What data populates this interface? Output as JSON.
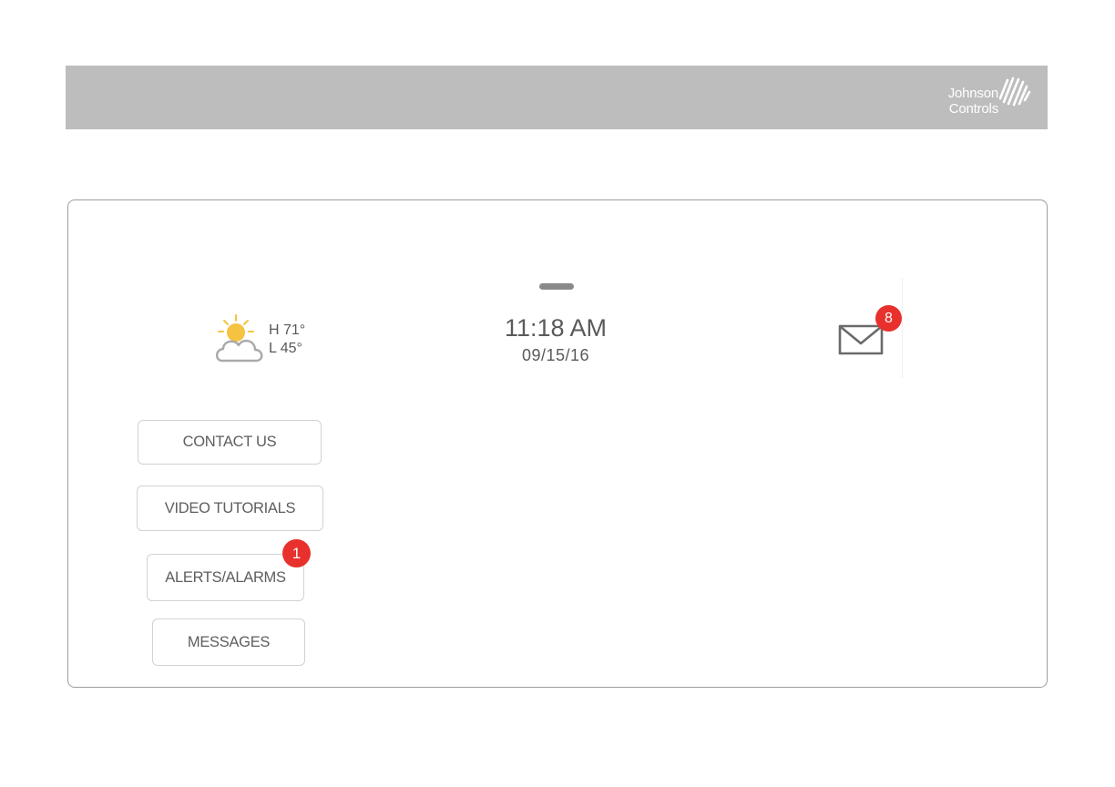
{
  "header": {
    "brand_line1": "Johnson",
    "brand_line2": "Controls",
    "background_color": "#bdbdbd"
  },
  "weather": {
    "icon": "partly-cloudy-icon",
    "high": "H 71°",
    "low": "L 45°"
  },
  "clock": {
    "time": "11:18 AM",
    "date": "09/15/16"
  },
  "mail": {
    "icon": "envelope-icon",
    "badge_count": "8"
  },
  "menu": {
    "contact_us": "CONTACT US",
    "video_tutorials": "VIDEO TUTORIALS",
    "alerts_alarms": "ALERTS/ALARMS",
    "alerts_badge": "1",
    "messages": "MESSAGES"
  },
  "colors": {
    "badge": "#e8302d",
    "text": "#5a5a5a",
    "sun": "#f5c242"
  }
}
